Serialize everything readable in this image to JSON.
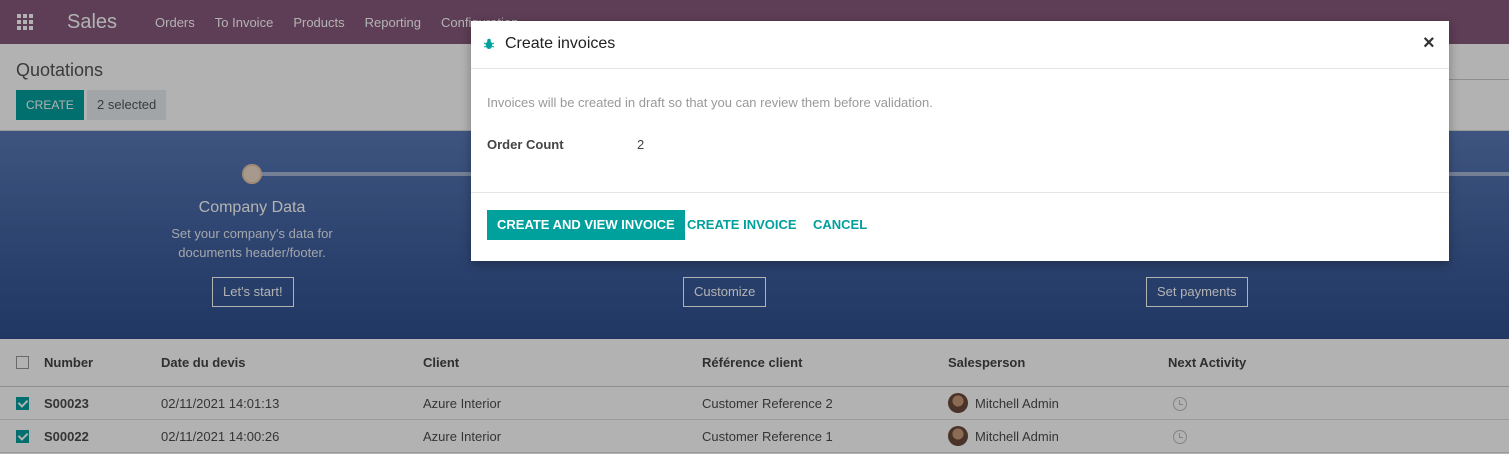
{
  "nav": {
    "brand": "Sales",
    "items": [
      "Orders",
      "To Invoice",
      "Products",
      "Reporting",
      "Configuration"
    ]
  },
  "control": {
    "breadcrumb": "Quotations",
    "create_label": "CREATE",
    "selected_label": "2 selected"
  },
  "banner": {
    "step_title": "Company Data",
    "step_desc": "Set your company's data for documents header/footer.",
    "buttons": [
      "Let's start!",
      "Customize",
      "Set payments"
    ]
  },
  "list": {
    "headers": [
      "Number",
      "Date du devis",
      "Client",
      "Référence client",
      "Salesperson",
      "Next Activity"
    ],
    "rows": [
      {
        "number": "S00023",
        "date": "02/11/2021 14:01:13",
        "client": "Azure Interior",
        "ref": "Customer Reference 2",
        "salesperson": "Mitchell Admin",
        "checked": true
      },
      {
        "number": "S00022",
        "date": "02/11/2021 14:00:26",
        "client": "Azure Interior",
        "ref": "Customer Reference 1",
        "salesperson": "Mitchell Admin",
        "checked": true
      }
    ]
  },
  "modal": {
    "title": "Create invoices",
    "close_symbol": "×",
    "info": "Invoices will be created in draft so that you can review them before validation.",
    "field_label": "Order Count",
    "field_value": "2",
    "buttons": {
      "primary": "CREATE AND VIEW INVOICE",
      "secondary": "CREATE INVOICE",
      "cancel": "CANCEL"
    }
  },
  "colors": {
    "nav": "#875a7b",
    "accent": "#00a09d"
  }
}
